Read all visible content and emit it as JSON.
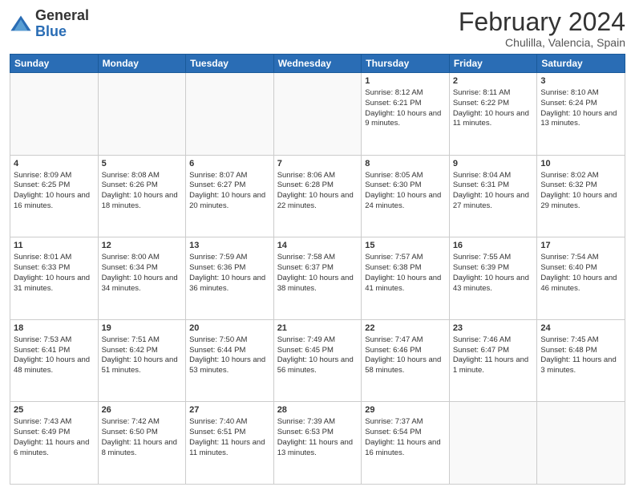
{
  "logo": {
    "general": "General",
    "blue": "Blue"
  },
  "header": {
    "title": "February 2024",
    "subtitle": "Chulilla, Valencia, Spain"
  },
  "days_of_week": [
    "Sunday",
    "Monday",
    "Tuesday",
    "Wednesday",
    "Thursday",
    "Friday",
    "Saturday"
  ],
  "weeks": [
    [
      {
        "day": "",
        "info": ""
      },
      {
        "day": "",
        "info": ""
      },
      {
        "day": "",
        "info": ""
      },
      {
        "day": "",
        "info": ""
      },
      {
        "day": "1",
        "info": "Sunrise: 8:12 AM\nSunset: 6:21 PM\nDaylight: 10 hours and 9 minutes."
      },
      {
        "day": "2",
        "info": "Sunrise: 8:11 AM\nSunset: 6:22 PM\nDaylight: 10 hours and 11 minutes."
      },
      {
        "day": "3",
        "info": "Sunrise: 8:10 AM\nSunset: 6:24 PM\nDaylight: 10 hours and 13 minutes."
      }
    ],
    [
      {
        "day": "4",
        "info": "Sunrise: 8:09 AM\nSunset: 6:25 PM\nDaylight: 10 hours and 16 minutes."
      },
      {
        "day": "5",
        "info": "Sunrise: 8:08 AM\nSunset: 6:26 PM\nDaylight: 10 hours and 18 minutes."
      },
      {
        "day": "6",
        "info": "Sunrise: 8:07 AM\nSunset: 6:27 PM\nDaylight: 10 hours and 20 minutes."
      },
      {
        "day": "7",
        "info": "Sunrise: 8:06 AM\nSunset: 6:28 PM\nDaylight: 10 hours and 22 minutes."
      },
      {
        "day": "8",
        "info": "Sunrise: 8:05 AM\nSunset: 6:30 PM\nDaylight: 10 hours and 24 minutes."
      },
      {
        "day": "9",
        "info": "Sunrise: 8:04 AM\nSunset: 6:31 PM\nDaylight: 10 hours and 27 minutes."
      },
      {
        "day": "10",
        "info": "Sunrise: 8:02 AM\nSunset: 6:32 PM\nDaylight: 10 hours and 29 minutes."
      }
    ],
    [
      {
        "day": "11",
        "info": "Sunrise: 8:01 AM\nSunset: 6:33 PM\nDaylight: 10 hours and 31 minutes."
      },
      {
        "day": "12",
        "info": "Sunrise: 8:00 AM\nSunset: 6:34 PM\nDaylight: 10 hours and 34 minutes."
      },
      {
        "day": "13",
        "info": "Sunrise: 7:59 AM\nSunset: 6:36 PM\nDaylight: 10 hours and 36 minutes."
      },
      {
        "day": "14",
        "info": "Sunrise: 7:58 AM\nSunset: 6:37 PM\nDaylight: 10 hours and 38 minutes."
      },
      {
        "day": "15",
        "info": "Sunrise: 7:57 AM\nSunset: 6:38 PM\nDaylight: 10 hours and 41 minutes."
      },
      {
        "day": "16",
        "info": "Sunrise: 7:55 AM\nSunset: 6:39 PM\nDaylight: 10 hours and 43 minutes."
      },
      {
        "day": "17",
        "info": "Sunrise: 7:54 AM\nSunset: 6:40 PM\nDaylight: 10 hours and 46 minutes."
      }
    ],
    [
      {
        "day": "18",
        "info": "Sunrise: 7:53 AM\nSunset: 6:41 PM\nDaylight: 10 hours and 48 minutes."
      },
      {
        "day": "19",
        "info": "Sunrise: 7:51 AM\nSunset: 6:42 PM\nDaylight: 10 hours and 51 minutes."
      },
      {
        "day": "20",
        "info": "Sunrise: 7:50 AM\nSunset: 6:44 PM\nDaylight: 10 hours and 53 minutes."
      },
      {
        "day": "21",
        "info": "Sunrise: 7:49 AM\nSunset: 6:45 PM\nDaylight: 10 hours and 56 minutes."
      },
      {
        "day": "22",
        "info": "Sunrise: 7:47 AM\nSunset: 6:46 PM\nDaylight: 10 hours and 58 minutes."
      },
      {
        "day": "23",
        "info": "Sunrise: 7:46 AM\nSunset: 6:47 PM\nDaylight: 11 hours and 1 minute."
      },
      {
        "day": "24",
        "info": "Sunrise: 7:45 AM\nSunset: 6:48 PM\nDaylight: 11 hours and 3 minutes."
      }
    ],
    [
      {
        "day": "25",
        "info": "Sunrise: 7:43 AM\nSunset: 6:49 PM\nDaylight: 11 hours and 6 minutes."
      },
      {
        "day": "26",
        "info": "Sunrise: 7:42 AM\nSunset: 6:50 PM\nDaylight: 11 hours and 8 minutes."
      },
      {
        "day": "27",
        "info": "Sunrise: 7:40 AM\nSunset: 6:51 PM\nDaylight: 11 hours and 11 minutes."
      },
      {
        "day": "28",
        "info": "Sunrise: 7:39 AM\nSunset: 6:53 PM\nDaylight: 11 hours and 13 minutes."
      },
      {
        "day": "29",
        "info": "Sunrise: 7:37 AM\nSunset: 6:54 PM\nDaylight: 11 hours and 16 minutes."
      },
      {
        "day": "",
        "info": ""
      },
      {
        "day": "",
        "info": ""
      }
    ]
  ]
}
